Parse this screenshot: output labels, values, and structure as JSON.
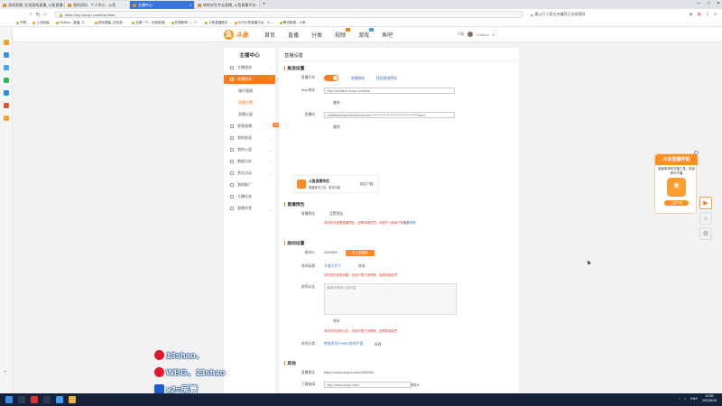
{
  "browser": {
    "tabs": [
      {
        "title": "游戏直播_在线游戏直播_斗鱼直播",
        "active": false
      },
      {
        "title": "我的资料 - 个人中心 - 斗鱼",
        "active": false
      },
      {
        "title": "主播中心",
        "active": true
      },
      {
        "title": "绝地求生专业直播_斗鱼直播平台",
        "active": false
      }
    ],
    "new_tab_symbol": "+",
    "url": "https://mp.douyu.com/live/main",
    "search_text": "唐山打人案五名嫌犯已全部落网",
    "bookmarks": [
      "书签",
      "上京网盘",
      "Chdken - 直播_斗…",
      "游戏直播_在线游…",
      "百度一下，你就知道",
      "热搜新闻（-_^）",
      "斗鱼直播助手",
      "今日头条直播平台 - 斗…",
      "腾讯影视 - 斗鱼"
    ]
  },
  "site": {
    "logo_text": "斗鱼",
    "nav": [
      "首页",
      "直播",
      "分类",
      "视频",
      "游戏",
      "鱼吧"
    ],
    "header_right": [
      "下载",
      "Chdken"
    ]
  },
  "sidebar": {
    "title": "主播中心",
    "items": [
      {
        "label": "主播相关",
        "active": false
      },
      {
        "label": "直播相关",
        "active": true
      },
      {
        "label": "视频直播",
        "active": false,
        "tag": "NEW"
      },
      {
        "label": "我的收益",
        "active": false
      },
      {
        "label": "我的公会",
        "active": false
      },
      {
        "label": "数据分析",
        "active": false
      },
      {
        "label": "营业活动",
        "active": false
      },
      {
        "label": "我的推广",
        "active": false
      },
      {
        "label": "主播任务",
        "active": false
      },
      {
        "label": "直播学堂",
        "active": false
      }
    ],
    "subitems": [
      {
        "label": "操作管理",
        "active": false
      },
      {
        "label": "直播设置",
        "active": true
      },
      {
        "label": "直播记录",
        "active": false
      }
    ]
  },
  "content": {
    "title": "直播设置",
    "stream": {
      "section": "推流设置",
      "switch_label": "直播开关",
      "switch_on": true,
      "switch_links": [
        "直播帮助",
        "找回推流密码"
      ],
      "rtmp_label": "rtmp地址",
      "rtmp_value": "rtmp://sendtc3.douyu.com/live",
      "copy": "复制",
      "code_label": "直播码",
      "code_value": "2465555rZeaD5imnTenSecret=************************************Rew7",
      "promo_title": "斗鱼直播伴侣",
      "promo_sub": "直播推流工具，更多功能",
      "promo_button": "前往下载"
    },
    "notice": {
      "section": "直播预告",
      "label": "直播预告",
      "button": "设置预告",
      "warn": "请勿发布虚假直播预告，违规将被处罚；请遵守斗鱼用户协议",
      "link": "查看说明"
    },
    "room": {
      "section": "房间设置",
      "id_label": "房间ID",
      "id_value": "2465555",
      "id_button": "进入直播间",
      "name_label": "房间标题",
      "name_value": "不准大开下",
      "name_edit": "修改",
      "name_warn": "请勿发布违规标题，包括不限于违规等，违规将被处罚",
      "intro_label": "房间公告",
      "intro_placeholder": "请填写房间公告内容",
      "intro_save": "保存",
      "intro_warn": "请勿发布违规公告，包括不限于违规等，违规将被处罚",
      "cate_label": "房间分类",
      "cate_value": "绝地求生/PUBG/吃鸡手游",
      "cate_edit": "修改"
    },
    "other": {
      "section": "其他",
      "addr_label": "直播地址",
      "addr_value": "https://www.douyu.com/2465555",
      "dl_label": "下载链接",
      "dl_value": "http://www.douyu.com/",
      "dl_select": "美化",
      "dl_warn": "请勿发布，下载链接将被公开推荐给一万人",
      "gift_label": "直播间礼物",
      "gift_value": "12",
      "gift_unit": "分",
      "gift_links": [
        "查看积分记录",
        "查看积分规则"
      ],
      "gift_warn1": "分数达到相应标准后有一定奖励相关；30分以下的直播间将取消直播，如有任何疑问请联系客服",
      "gift_warn2": "分数，违规的将被永久封禁处罚"
    }
  },
  "float_ad": {
    "title": "斗鱼直播伴侣",
    "text": "超级简单的开播工具，安装即可开播",
    "app_label": "鱼",
    "download": "立即下载",
    "close": "×"
  },
  "watermark": [
    "13shao、",
    "WBG、13shao",
    "x2=房管"
  ],
  "taskbar": {
    "lang": "ENG",
    "time": "20:55",
    "date": "2022/6/16"
  },
  "colors": {
    "accent": "#ff7a1a",
    "link": "#2f6fd0",
    "warn": "#e43d30",
    "taskbar": "#16223a"
  }
}
